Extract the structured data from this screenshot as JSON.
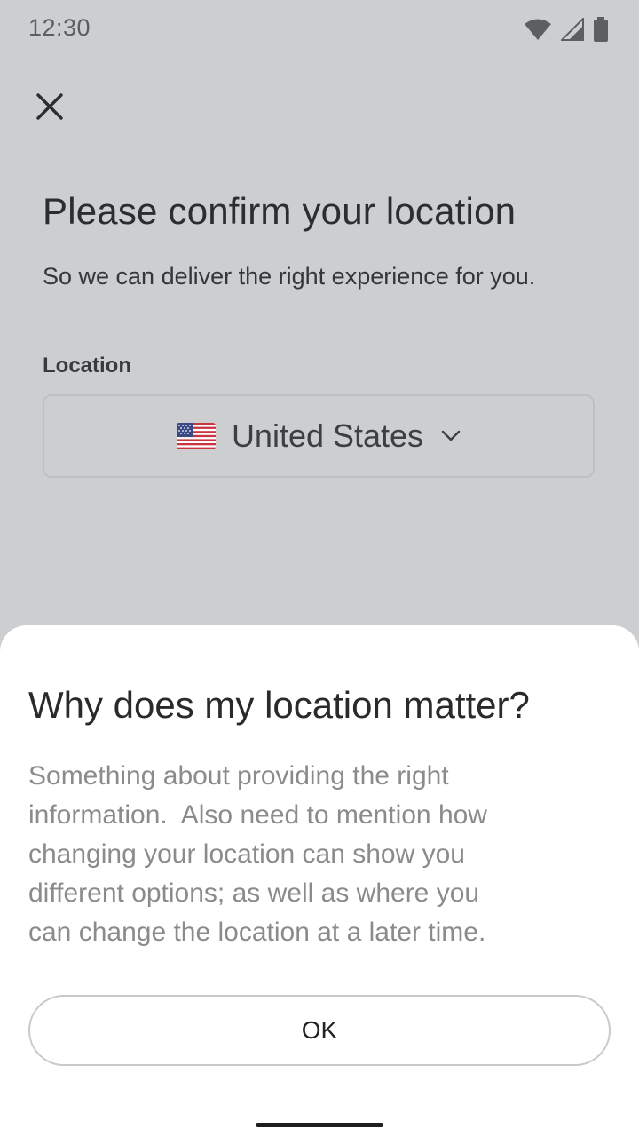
{
  "status_bar": {
    "time": "12:30",
    "icons": [
      "wifi-icon",
      "cellular-signal-icon",
      "battery-icon"
    ]
  },
  "header": {
    "close_icon": "close-icon"
  },
  "main": {
    "title": "Please confirm your location",
    "subtitle": "So we can deliver the right experience for you.",
    "location_label": "Location",
    "location_select": {
      "flag_icon": "us-flag-icon",
      "value": "United States",
      "chevron_icon": "chevron-down-icon"
    }
  },
  "bottom_sheet": {
    "title": "Why does my location matter?",
    "body": "Something about providing the right\ninformation.  Also need to mention how\nchanging your location can show you\ndifferent options; as well as where you\ncan change the location at a later time.",
    "ok_label": "OK"
  },
  "colors": {
    "background_dim": "#cdcecf",
    "sheet_background": "#ffffff",
    "body_text": "#8a8b8d",
    "border": "#c8c9cb"
  }
}
